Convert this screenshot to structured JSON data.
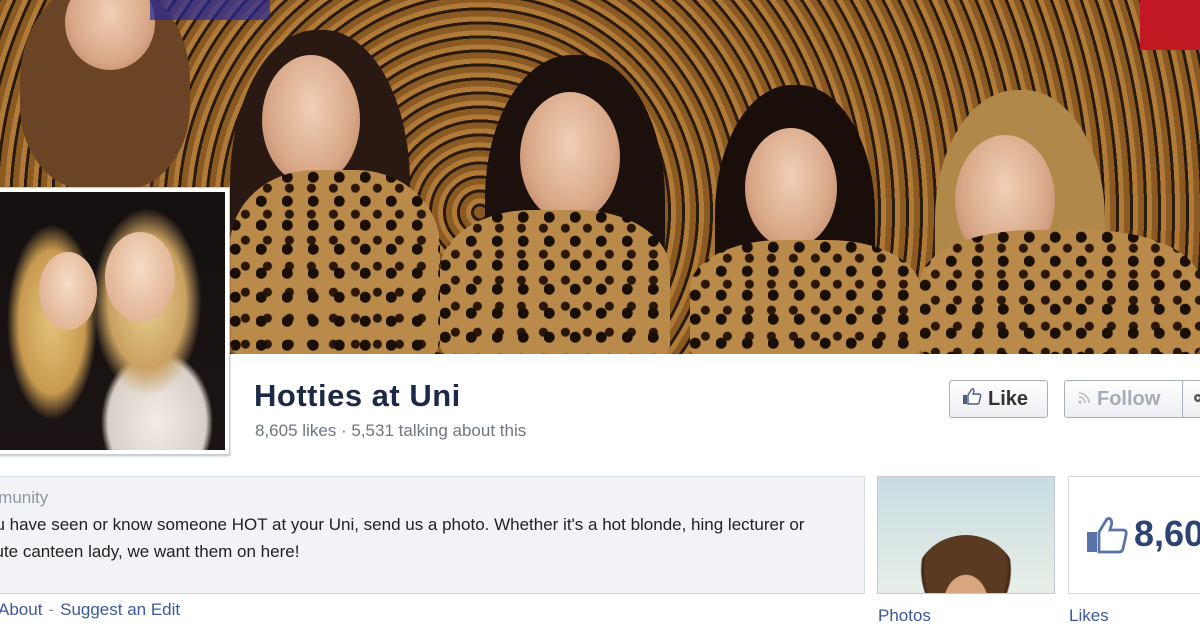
{
  "page": {
    "title": "Hotties at Uni",
    "stats": "8,605 likes · 5,531 talking about this"
  },
  "actions": {
    "like_label": "Like",
    "follow_label": "Follow"
  },
  "about": {
    "category": "mmunity",
    "description": "ou have seen or know someone HOT at your Uni, send us a photo. Whether it's a hot blonde, hing lecturer or cute canteen lady, we want them on here!",
    "links": [
      "About",
      "Suggest an Edit"
    ]
  },
  "tiles": {
    "photos_label": "Photos",
    "likes_count": "8,60",
    "likes_label": "Likes"
  },
  "colors": {
    "title": "#1c2a47",
    "link": "#3b5998",
    "likes_count": "#2d4373",
    "muted": "#8d96a5"
  },
  "icons": {
    "like_button": "thumbs-up-icon",
    "follow_button": "rss-icon",
    "likes_tile": "thumbs-up-icon"
  }
}
